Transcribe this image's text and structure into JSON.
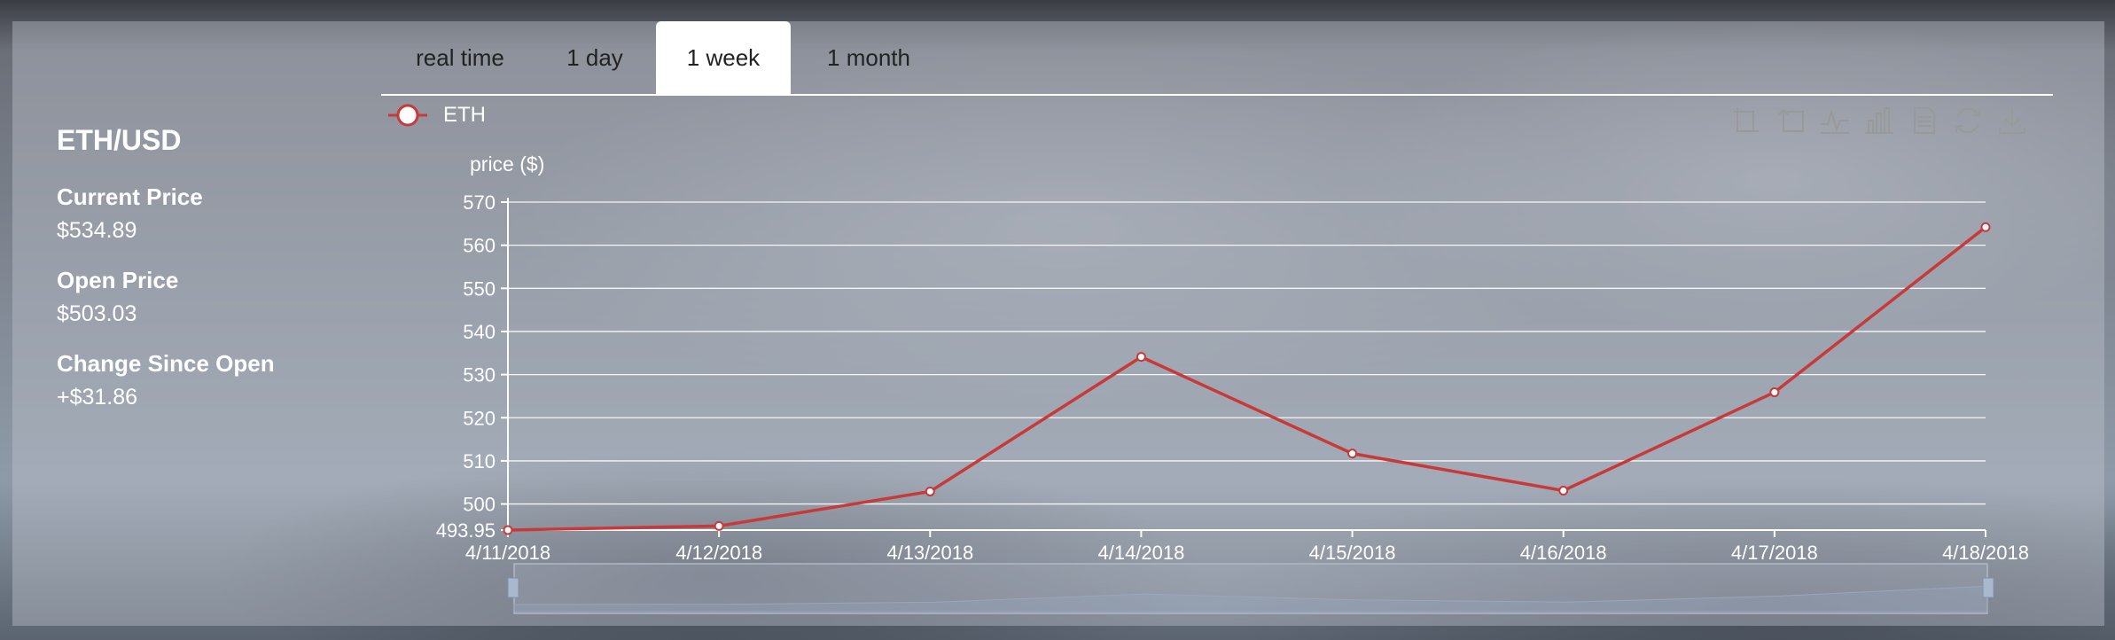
{
  "ticker": {
    "pair": "ETH/USD",
    "current_label": "Current Price",
    "current_value": "$534.89",
    "open_label": "Open Price",
    "open_value": "$503.03",
    "change_label": "Change Since Open",
    "change_value": "+$31.86"
  },
  "tabs": [
    {
      "label": "real time"
    },
    {
      "label": "1 day"
    },
    {
      "label": "1 week",
      "active": true
    },
    {
      "label": "1 month"
    }
  ],
  "toolbox": [
    "zoom-select-icon",
    "zoom-reset-icon",
    "line-chart-icon",
    "bar-chart-icon",
    "data-view-icon",
    "restore-icon",
    "download-icon"
  ],
  "colors": {
    "series": "#c83a3a",
    "text": "#ffffff",
    "grid": "#ffffff"
  },
  "chart_data": {
    "type": "line",
    "ylabel": "price ($)",
    "xlabel": "",
    "ylim": [
      493.95,
      570
    ],
    "yticks": [
      570,
      560,
      550,
      540,
      530,
      520,
      510,
      500,
      493.95
    ],
    "grid": true,
    "legend_placement": "top-left",
    "categories": [
      "4/11/2018",
      "4/12/2018",
      "4/13/2018",
      "4/14/2018",
      "4/15/2018",
      "4/16/2018",
      "4/17/2018",
      "4/18/2018"
    ],
    "series": [
      {
        "name": "ETH",
        "values": [
          493.95,
          494.9,
          502.9,
          534.1,
          511.7,
          503.1,
          525.9,
          564.2
        ]
      }
    ]
  }
}
